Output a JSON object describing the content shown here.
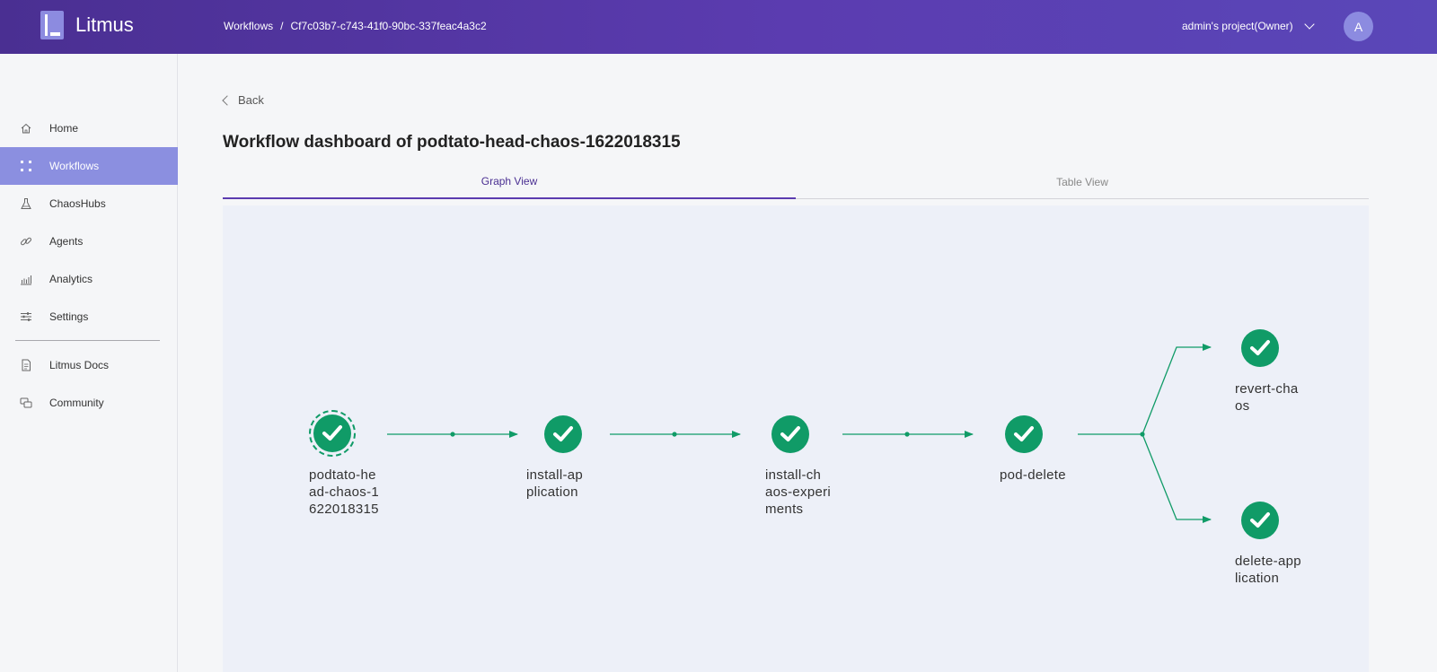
{
  "header": {
    "brand": "Litmus",
    "breadcrumb_root": "Workflows",
    "breadcrumb_sep": "/",
    "breadcrumb_current": "Cf7c03b7-c743-41f0-90bc-337feac4a3c2",
    "project": "admin's project(Owner)",
    "avatar_initial": "A"
  },
  "sidebar": {
    "items": [
      {
        "label": "Home",
        "icon": "home-icon"
      },
      {
        "label": "Workflows",
        "icon": "workflows-icon",
        "active": true
      },
      {
        "label": "ChaosHubs",
        "icon": "flask-icon"
      },
      {
        "label": "Agents",
        "icon": "link-icon"
      },
      {
        "label": "Analytics",
        "icon": "analytics-icon"
      },
      {
        "label": "Settings",
        "icon": "settings-icon"
      },
      {
        "label": "Litmus Docs",
        "icon": "document-icon"
      },
      {
        "label": "Community",
        "icon": "community-icon"
      }
    ]
  },
  "main": {
    "back_label": "Back",
    "title": "Workflow dashboard of podtato-head-chaos-1622018315",
    "tabs": [
      {
        "label": "Graph View",
        "active": true
      },
      {
        "label": "Table View",
        "active": false
      }
    ]
  },
  "graph": {
    "status_color": "#109b67",
    "nodes": [
      {
        "lines": [
          "podtato-he",
          "ad-chaos-1",
          "622018315"
        ],
        "root": true
      },
      {
        "lines": [
          "install-ap",
          "plication"
        ]
      },
      {
        "lines": [
          "install-ch",
          "aos-experi",
          "ments"
        ]
      },
      {
        "lines": [
          "pod-delete"
        ]
      },
      {
        "lines": [
          "revert-cha",
          "os"
        ]
      },
      {
        "lines": [
          "delete-app",
          "lication"
        ]
      }
    ]
  }
}
